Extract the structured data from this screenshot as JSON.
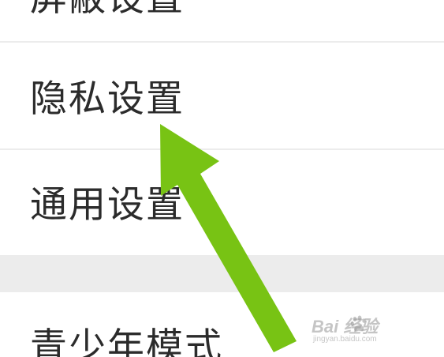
{
  "settings_list": {
    "items": [
      {
        "label": "屏蔽设置"
      },
      {
        "label": "隐私设置"
      },
      {
        "label": "通用设置"
      },
      {
        "label": "青少年模式"
      }
    ]
  },
  "annotation": {
    "arrow_color": "#78c314",
    "arrow_icon": "up-left-arrow-icon"
  },
  "watermark": {
    "brand": "Bai  经验",
    "url": "jingyan.baidu.com"
  }
}
